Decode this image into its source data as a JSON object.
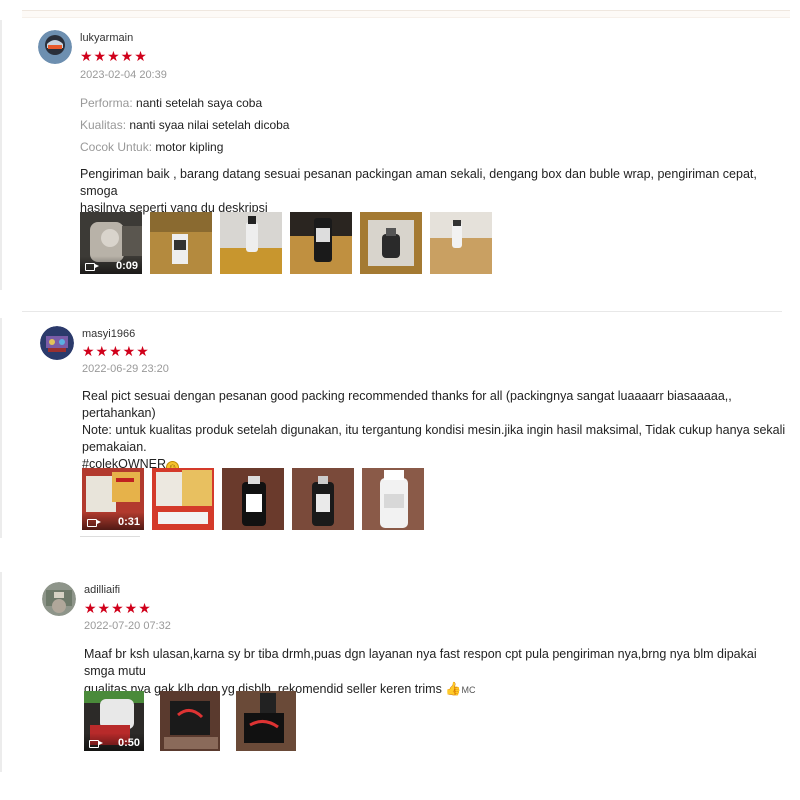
{
  "reviews": [
    {
      "username": "lukyarmain",
      "stars": "★★★★★",
      "timestamp": "2023-02-04 20:39",
      "attributes": [
        {
          "key": "Performa:",
          "value": "nanti setelah saya coba"
        },
        {
          "key": "Kualitas:",
          "value": "nanti syaa nilai setelah dicoba"
        },
        {
          "key": "Cocok Untuk:",
          "value": "motor kipling"
        }
      ],
      "body_lines": [
        "Pengiriman baik , barang datang sesuai pesanan packingan aman sekali, dengang box dan buble wrap, pengiriman cepat, smoga",
        "hasilnya seperti yang du deskripsi"
      ],
      "video_duration": "0:09"
    },
    {
      "username": "masyi1966",
      "stars": "★★★★★",
      "timestamp": "2022-06-29 23:20",
      "body_lines": [
        "Real pict sesuai dengan pesanan good packing recommended thanks for all (packingnya sangat luaaaarr biasaaaaa,, pertahankan)",
        "Note: untuk kualitas produk setelah digunakan, itu tergantung kondisi mesin.jika ingin hasil maksimal, Tidak cukup hanya sekali",
        "pemakaian.",
        "#colekOWNER"
      ],
      "video_duration": "0:31"
    },
    {
      "username": "adilliaifi",
      "stars": "★★★★★",
      "timestamp": "2022-07-20 07:32",
      "body_lines": [
        "Maaf br ksh ulasan,karna sy br tiba drmh,puas dgn layanan nya fast respon cpt pula pengiriman nya,brng nya blm dipakai smga mutu",
        "qualitas nya gak klh dgn yg disblh, rekomendid seller keren trims"
      ],
      "body_suffix": "MC",
      "video_duration": "0:50"
    }
  ],
  "icons": [
    "video-icon",
    "smile-emoji-icon",
    "thumbs-up-icon"
  ]
}
